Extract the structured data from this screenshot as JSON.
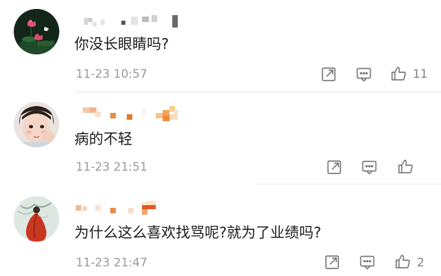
{
  "comments": [
    {
      "avatar": "lotus-flower-avatar",
      "username_censored": true,
      "text": "你没长眼睛吗?",
      "time": "11-23 10:57",
      "actions": {
        "share_icon": "share-icon",
        "reply_icon": "comment-icon",
        "like_icon": "thumbs-up-icon"
      },
      "likes": "11"
    },
    {
      "avatar": "child-portrait-avatar",
      "username_censored": true,
      "text": "病的不轻",
      "time": "11-23 21:51",
      "actions": {
        "share_icon": "share-icon",
        "reply_icon": "comment-icon",
        "like_icon": "thumbs-up-icon"
      },
      "likes": ""
    },
    {
      "avatar": "red-robe-figure-avatar",
      "username_censored": true,
      "text": "为什么这么喜欢找骂呢?就为了业绩吗?",
      "time": "11-23 21:47",
      "actions": {
        "share_icon": "share-icon",
        "reply_icon": "comment-icon",
        "like_icon": "thumbs-up-icon"
      },
      "likes": "2"
    }
  ],
  "colors": {
    "text": "#1b1b1b",
    "meta": "#9a9a9a",
    "icon": "#7a7a7a",
    "divider": "#e6e6e6"
  }
}
